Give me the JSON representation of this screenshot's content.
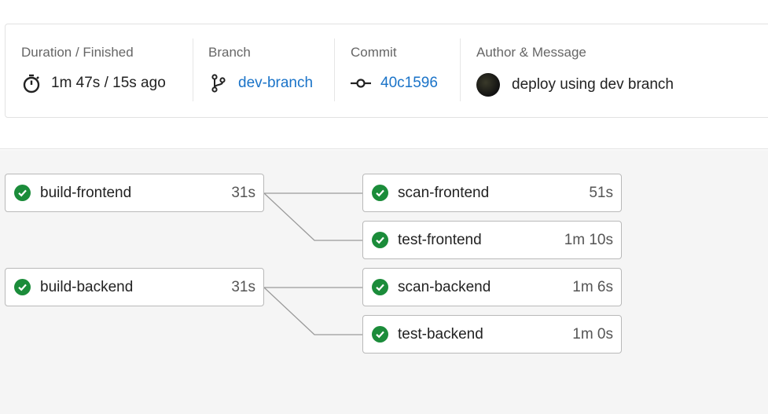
{
  "summary": {
    "duration": {
      "label": "Duration / Finished",
      "value": "1m 47s / 15s ago",
      "icon": "stopwatch-icon"
    },
    "branch": {
      "label": "Branch",
      "value": "dev-branch",
      "icon": "git-branch-icon"
    },
    "commit": {
      "label": "Commit",
      "value": "40c1596",
      "icon": "git-commit-icon"
    },
    "author": {
      "label": "Author & Message",
      "message": "deploy using dev branch"
    }
  },
  "jobs": [
    {
      "name": "build-frontend",
      "duration": "31s",
      "status": "success"
    },
    {
      "name": "scan-frontend",
      "duration": "51s",
      "status": "success"
    },
    {
      "name": "test-frontend",
      "duration": "1m 10s",
      "status": "success"
    },
    {
      "name": "build-backend",
      "duration": "31s",
      "status": "success"
    },
    {
      "name": "scan-backend",
      "duration": "1m 6s",
      "status": "success"
    },
    {
      "name": "test-backend",
      "duration": "1m 0s",
      "status": "success"
    }
  ],
  "colors": {
    "success": "#1b8c3a",
    "link": "#1a73c8",
    "graph_bg": "#f5f5f5"
  }
}
